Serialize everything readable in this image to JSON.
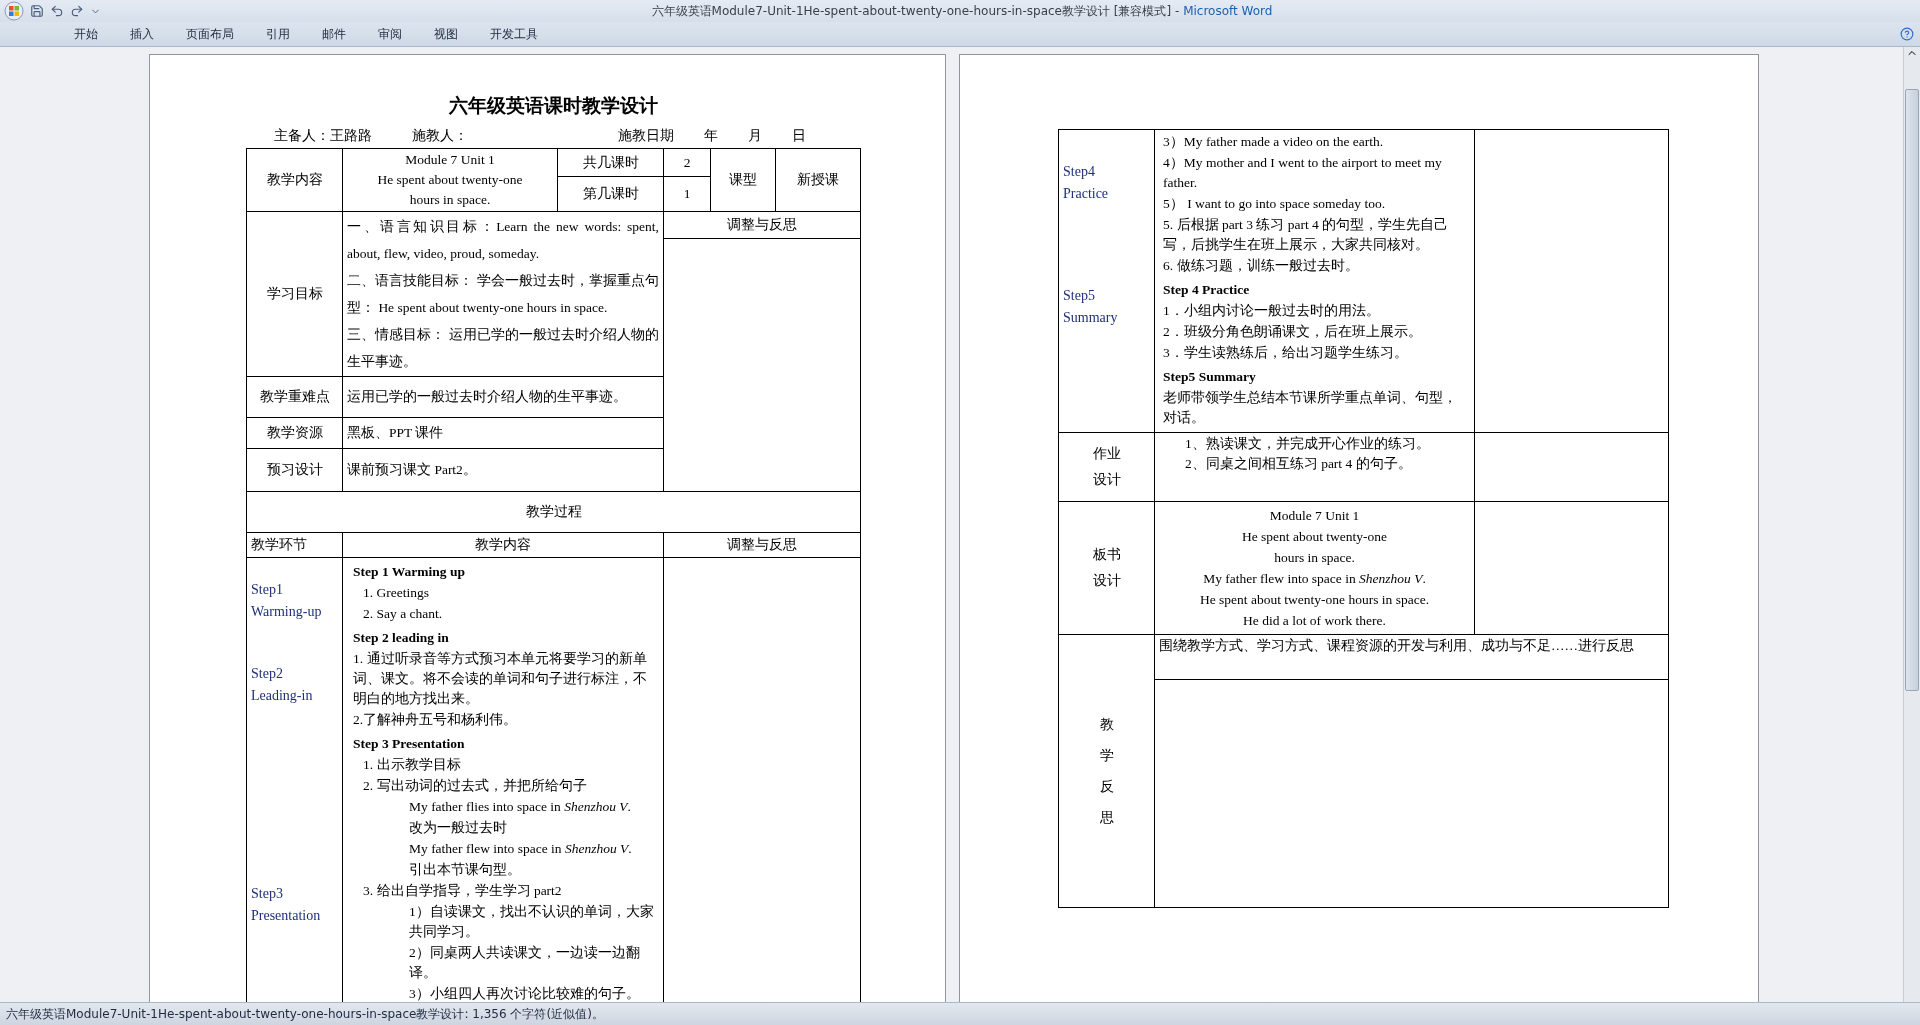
{
  "window": {
    "title": "六年级英语Module7-Unit-1He-spent-about-twenty-one-hours-in-space教学设计 [兼容模式]",
    "title_separator": "-",
    "app_name": "Microsoft Word"
  },
  "ribbon_tabs": [
    "开始",
    "插入",
    "页面布局",
    "引用",
    "邮件",
    "审阅",
    "视图",
    "开发工具"
  ],
  "page_1": {
    "heading": "六年级英语课时教学设计",
    "info_line": [
      "主备人：王路路",
      "施教人：",
      "施教日期",
      "年",
      "月",
      "日"
    ],
    "overview": {
      "content_label": "教学内容",
      "content_lines": [
        "Module 7 Unit 1",
        "He spent about twenty-one",
        "hours in space."
      ],
      "periods_total_label": "共几课时",
      "periods_total": "2",
      "period_label": "第几课时",
      "period": "1",
      "type_label": "课型",
      "type": "新授课",
      "goals_label": "学习目标",
      "goals": [
        "一、语言知识目标：Learn the new words: spent, about, flew, video, proud, someday.",
        "二、语言技能目标： 学会一般过去时，掌握重点句型： He spent about twenty-one hours in space.",
        "三、情感目标： 运用已学的一般过去时介绍人物的生平事迹。"
      ],
      "reflection_label": "调整与反思",
      "rows": [
        {
          "label": "教学重难点",
          "text": "运用已学的一般过去时介绍人物的生平事迹。"
        },
        {
          "label": "教学资源",
          "text": "黑板、PPT 课件"
        },
        {
          "label": "预习设计",
          "text": "课前预习课文 Part2。"
        }
      ]
    },
    "process": {
      "title": "教学过程",
      "columns": [
        "教学环节",
        "教学内容",
        "调整与反思"
      ],
      "stages": [
        {
          "lines": [
            "Step1",
            "Warming-up"
          ]
        },
        {
          "lines": [
            "Step2",
            "Leading-in"
          ]
        },
        {
          "lines": [
            "Step3",
            "Presentation"
          ]
        }
      ],
      "content": [
        {
          "kind": "heading",
          "text": "Step 1 Warming up"
        },
        {
          "kind": "item",
          "text": "1. Greetings"
        },
        {
          "kind": "item",
          "text": "2. Say a chant."
        },
        {
          "kind": "heading",
          "text": "Step 2 leading in"
        },
        {
          "kind": "para",
          "text": "1. 通过听录音等方式预习本单元将要学习的新单词、课文。将不会读的单词和句子进行标注，不明白的地方找出来。"
        },
        {
          "kind": "para",
          "text": "2.了解神舟五号和杨利伟。"
        },
        {
          "kind": "heading",
          "text": "Step 3 Presentation"
        },
        {
          "kind": "item",
          "text": "1.  出示教学目标"
        },
        {
          "kind": "item",
          "text": "2.  写出动词的过去式，并把所给句子",
          "children": [
            {
              "kind": "para",
              "text": "My father flies into space in *Shenzhou V*."
            },
            {
              "kind": "para",
              "text": "改为一般过去时"
            },
            {
              "kind": "para",
              "text": "My father flew into space in *Shenzhou V*."
            },
            {
              "kind": "para",
              "text": "引出本节课句型。"
            }
          ]
        },
        {
          "kind": "item",
          "text": "3.  给出自学指导，学生学习 part2",
          "children": [
            {
              "kind": "para",
              "text": "1）自读课文，找出不认识的单词，大家共同学习。"
            },
            {
              "kind": "para",
              "text": "2）同桌两人共读课文，一边读一边翻译。"
            },
            {
              "kind": "para",
              "text": "3）小组四人再次讨论比较难的句子。"
            }
          ]
        }
      ]
    }
  },
  "page_2": {
    "process_continued": {
      "stages": [
        {
          "lines": [
            "Step4",
            "Practice"
          ]
        },
        {
          "lines": [
            "Step5",
            "Summary"
          ]
        }
      ],
      "content": [
        {
          "kind": "para",
          "text": "3）My father made a video on the earth."
        },
        {
          "kind": "para",
          "text": "4）My mother and I went to the airport to meet my father."
        },
        {
          "kind": "para",
          "text": "5） I want to go into space someday too."
        },
        {
          "kind": "para",
          "text": "5. 后根据 part 3 练习 part 4 的句型，学生先自己写，后挑学生在班上展示，大家共同核对。"
        },
        {
          "kind": "para",
          "text": "6. 做练习题，训练一般过去时。"
        },
        {
          "kind": "heading",
          "text": "Step 4 Practice"
        },
        {
          "kind": "para",
          "text": "1．小组内讨论一般过去时的用法。"
        },
        {
          "kind": "para",
          "text": "2．班级分角色朗诵课文，后在班上展示。"
        },
        {
          "kind": "para",
          "text": "3．学生读熟练后，给出习题学生练习。"
        },
        {
          "kind": "heading",
          "text": "Step5 Summary"
        },
        {
          "kind": "para",
          "text": "老师带领学生总结本节课所学重点单词、句型，对话。"
        }
      ]
    },
    "homework": {
      "label_lines": [
        "作业",
        "设计"
      ],
      "lines": [
        "1、熟读课文，并完成开心作业的练习。",
        "2、同桌之间相互练习 part 4 的句子。"
      ]
    },
    "board": {
      "label_lines": [
        "板书",
        "设计"
      ],
      "lines": [
        "Module 7 Unit 1",
        "He spent about twenty-one",
        "hours in space.",
        "My father flew into space in *Shenzhou V*.",
        "He spent about twenty-one hours in space.",
        "He did a lot of work there."
      ]
    },
    "reflection": {
      "label_chars": [
        "教",
        "学",
        "反",
        "思"
      ],
      "prompt": "围绕教学方式、学习方式、课程资源的开发与利用、成功与不足……进行反思"
    }
  },
  "status_bar": "六年级英语Module7-Unit-1He-spent-about-twenty-one-hours-in-space教学设计: 1,356 个字符(近似值)。"
}
